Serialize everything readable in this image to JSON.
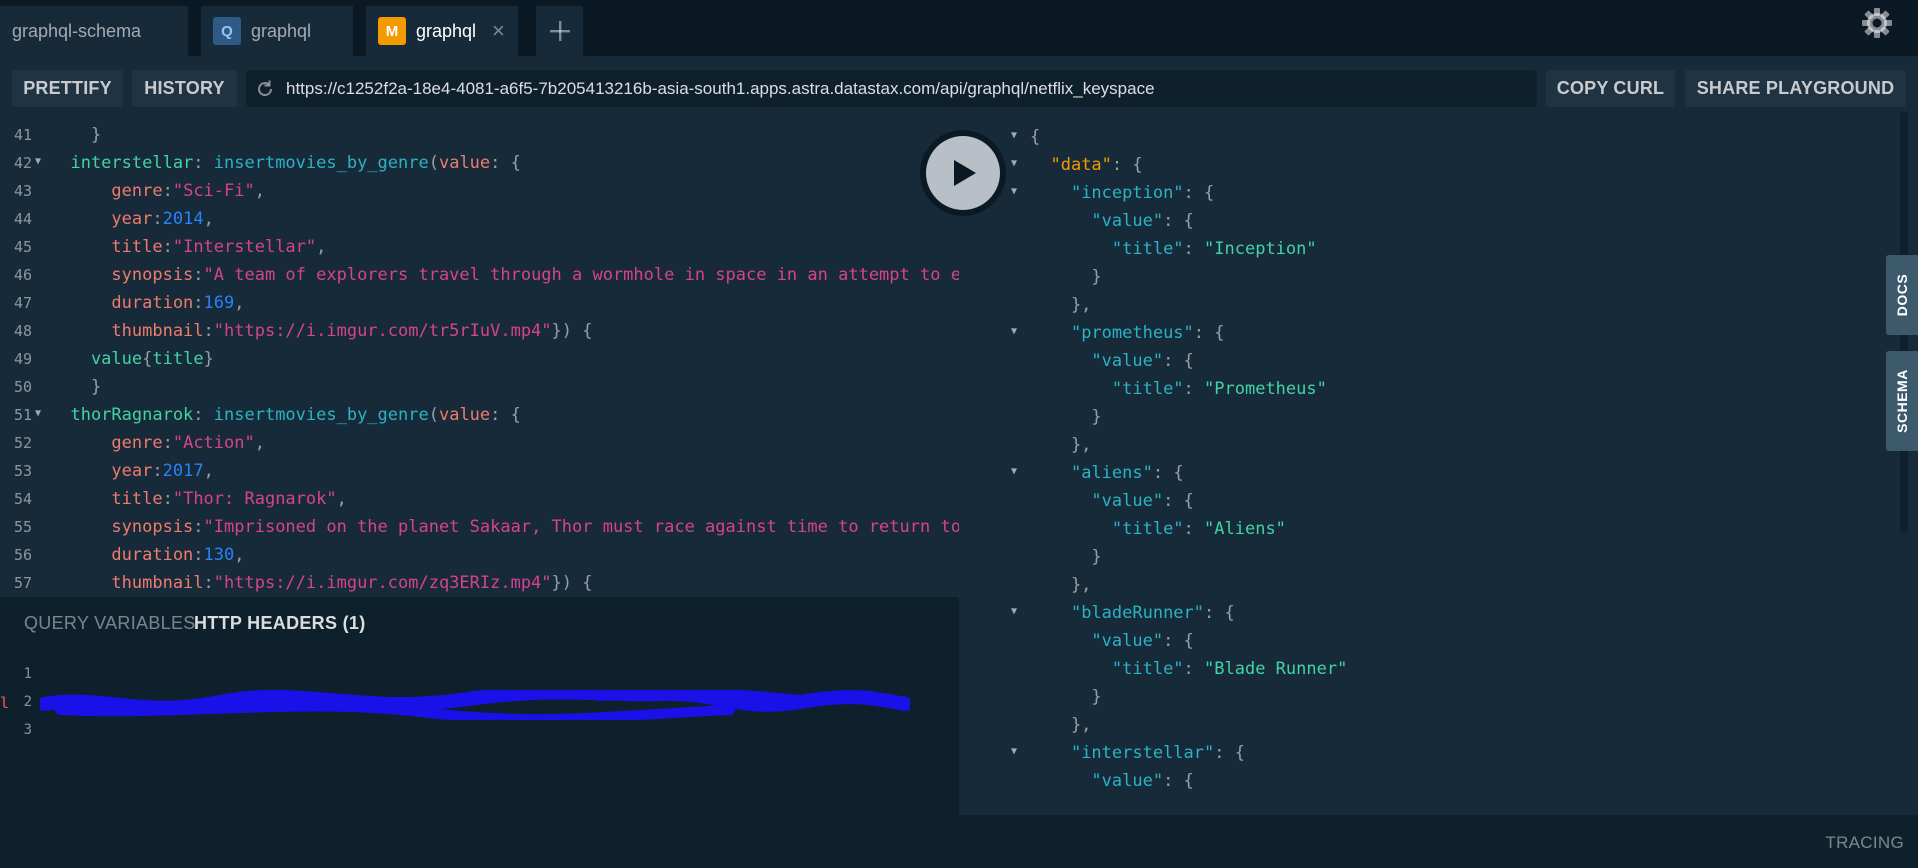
{
  "tabs": [
    {
      "label": "graphql-schema",
      "badge": ""
    },
    {
      "label": "graphql",
      "badge": "Q"
    },
    {
      "label": "graphql",
      "badge": "M",
      "close": "×"
    }
  ],
  "add_tab_icon": "+",
  "toolbar": {
    "prettify": "PRETTIFY",
    "history": "HISTORY",
    "url": "https://c1252f2a-18e4-4081-a6f5-7b205413216b-asia-south1.apps.astra.datastax.com/api/graphql/netflix_keyspace",
    "copy_curl": "COPY CURL",
    "share": "SHARE PLAYGROUND"
  },
  "editor": {
    "lines": [
      {
        "n": "41",
        "fold": false,
        "indent": 0,
        "tokens": [
          {
            "t": "    }",
            "c": "punc"
          }
        ]
      },
      {
        "n": "42",
        "fold": true,
        "indent": 0,
        "tokens": [
          {
            "t": "  interstellar",
            "c": "field"
          },
          {
            "t": ": ",
            "c": "punc"
          },
          {
            "t": "insertmovies_by_genre",
            "c": "def"
          },
          {
            "t": "(",
            "c": "punc"
          },
          {
            "t": "value",
            "c": "attr"
          },
          {
            "t": ": {",
            "c": "punc"
          }
        ]
      },
      {
        "n": "43",
        "fold": false,
        "indent": 0,
        "tokens": [
          {
            "t": "      genre",
            "c": "attr"
          },
          {
            "t": ":",
            "c": "punc"
          },
          {
            "t": "\"Sci-Fi\"",
            "c": "str"
          },
          {
            "t": ",",
            "c": "punc"
          }
        ]
      },
      {
        "n": "44",
        "fold": false,
        "indent": 0,
        "tokens": [
          {
            "t": "      year",
            "c": "attr"
          },
          {
            "t": ":",
            "c": "punc"
          },
          {
            "t": "2014",
            "c": "num"
          },
          {
            "t": ",",
            "c": "punc"
          }
        ]
      },
      {
        "n": "45",
        "fold": false,
        "indent": 0,
        "tokens": [
          {
            "t": "      title",
            "c": "attr"
          },
          {
            "t": ":",
            "c": "punc"
          },
          {
            "t": "\"Interstellar\"",
            "c": "str"
          },
          {
            "t": ",",
            "c": "punc"
          }
        ]
      },
      {
        "n": "46",
        "fold": false,
        "indent": 0,
        "tokens": [
          {
            "t": "      synopsis",
            "c": "attr"
          },
          {
            "t": ":",
            "c": "punc"
          },
          {
            "t": "\"A team of explorers travel through a wormhole in space in an attempt to e",
            "c": "str"
          }
        ]
      },
      {
        "n": "47",
        "fold": false,
        "indent": 0,
        "tokens": [
          {
            "t": "      duration",
            "c": "attr"
          },
          {
            "t": ":",
            "c": "punc"
          },
          {
            "t": "169",
            "c": "num"
          },
          {
            "t": ",",
            "c": "punc"
          }
        ]
      },
      {
        "n": "48",
        "fold": false,
        "indent": 0,
        "tokens": [
          {
            "t": "      thumbnail",
            "c": "attr"
          },
          {
            "t": ":",
            "c": "punc"
          },
          {
            "t": "\"https://i.imgur.com/tr5rIuV.mp4\"",
            "c": "str"
          },
          {
            "t": "}) {",
            "c": "punc"
          }
        ]
      },
      {
        "n": "49",
        "fold": false,
        "indent": 0,
        "tokens": [
          {
            "t": "    value",
            "c": "field"
          },
          {
            "t": "{",
            "c": "punc"
          },
          {
            "t": "title",
            "c": "field"
          },
          {
            "t": "}",
            "c": "punc"
          }
        ]
      },
      {
        "n": "50",
        "fold": false,
        "indent": 0,
        "tokens": [
          {
            "t": "    }",
            "c": "punc"
          }
        ]
      },
      {
        "n": "51",
        "fold": true,
        "indent": 0,
        "tokens": [
          {
            "t": "  thorRagnarok",
            "c": "field"
          },
          {
            "t": ": ",
            "c": "punc"
          },
          {
            "t": "insertmovies_by_genre",
            "c": "def"
          },
          {
            "t": "(",
            "c": "punc"
          },
          {
            "t": "value",
            "c": "attr"
          },
          {
            "t": ": {",
            "c": "punc"
          }
        ]
      },
      {
        "n": "52",
        "fold": false,
        "indent": 0,
        "tokens": [
          {
            "t": "      genre",
            "c": "attr"
          },
          {
            "t": ":",
            "c": "punc"
          },
          {
            "t": "\"Action\"",
            "c": "str"
          },
          {
            "t": ",",
            "c": "punc"
          }
        ]
      },
      {
        "n": "53",
        "fold": false,
        "indent": 0,
        "tokens": [
          {
            "t": "      year",
            "c": "attr"
          },
          {
            "t": ":",
            "c": "punc"
          },
          {
            "t": "2017",
            "c": "num"
          },
          {
            "t": ",",
            "c": "punc"
          }
        ]
      },
      {
        "n": "54",
        "fold": false,
        "indent": 0,
        "tokens": [
          {
            "t": "      title",
            "c": "attr"
          },
          {
            "t": ":",
            "c": "punc"
          },
          {
            "t": "\"Thor: Ragnarok\"",
            "c": "str"
          },
          {
            "t": ",",
            "c": "punc"
          }
        ]
      },
      {
        "n": "55",
        "fold": false,
        "indent": 0,
        "tokens": [
          {
            "t": "      synopsis",
            "c": "attr"
          },
          {
            "t": ":",
            "c": "punc"
          },
          {
            "t": "\"Imprisoned on the planet Sakaar, Thor must race against time to return to",
            "c": "str"
          }
        ]
      },
      {
        "n": "56",
        "fold": false,
        "indent": 0,
        "tokens": [
          {
            "t": "      duration",
            "c": "attr"
          },
          {
            "t": ":",
            "c": "punc"
          },
          {
            "t": "130",
            "c": "num"
          },
          {
            "t": ",",
            "c": "punc"
          }
        ]
      },
      {
        "n": "57",
        "fold": false,
        "indent": 0,
        "tokens": [
          {
            "t": "      thumbnail",
            "c": "attr"
          },
          {
            "t": ":",
            "c": "punc"
          },
          {
            "t": "\"https://i.imgur.com/zq3ERIz.mp4\"",
            "c": "str"
          },
          {
            "t": "}) {",
            "c": "punc"
          }
        ]
      }
    ]
  },
  "variables": {
    "tab_query": "QUERY VARIABLES",
    "tab_headers": "HTTP HEADERS (1)",
    "line_numbers": [
      "1",
      "2",
      "3"
    ]
  },
  "result": {
    "lines": [
      {
        "fold": true,
        "tokens": [
          {
            "t": "{",
            "c": "punc"
          }
        ]
      },
      {
        "fold": true,
        "tokens": [
          {
            "t": "  ",
            "c": "punc"
          },
          {
            "t": "\"data\"",
            "c": "key-top"
          },
          {
            "t": ": {",
            "c": "punc"
          }
        ]
      },
      {
        "fold": true,
        "tokens": [
          {
            "t": "    ",
            "c": "punc"
          },
          {
            "t": "\"inception\"",
            "c": "key"
          },
          {
            "t": ": {",
            "c": "punc"
          }
        ]
      },
      {
        "fold": false,
        "tokens": [
          {
            "t": "      ",
            "c": "punc"
          },
          {
            "t": "\"value\"",
            "c": "key"
          },
          {
            "t": ": {",
            "c": "punc"
          }
        ]
      },
      {
        "fold": false,
        "tokens": [
          {
            "t": "        ",
            "c": "punc"
          },
          {
            "t": "\"title\"",
            "c": "key"
          },
          {
            "t": ": ",
            "c": "punc"
          },
          {
            "t": "\"Inception\"",
            "c": "sval"
          }
        ]
      },
      {
        "fold": false,
        "tokens": [
          {
            "t": "      }",
            "c": "punc"
          }
        ]
      },
      {
        "fold": false,
        "tokens": [
          {
            "t": "    },",
            "c": "punc"
          }
        ]
      },
      {
        "fold": true,
        "tokens": [
          {
            "t": "    ",
            "c": "punc"
          },
          {
            "t": "\"prometheus\"",
            "c": "key"
          },
          {
            "t": ": {",
            "c": "punc"
          }
        ]
      },
      {
        "fold": false,
        "tokens": [
          {
            "t": "      ",
            "c": "punc"
          },
          {
            "t": "\"value\"",
            "c": "key"
          },
          {
            "t": ": {",
            "c": "punc"
          }
        ]
      },
      {
        "fold": false,
        "tokens": [
          {
            "t": "        ",
            "c": "punc"
          },
          {
            "t": "\"title\"",
            "c": "key"
          },
          {
            "t": ": ",
            "c": "punc"
          },
          {
            "t": "\"Prometheus\"",
            "c": "sval"
          }
        ]
      },
      {
        "fold": false,
        "tokens": [
          {
            "t": "      }",
            "c": "punc"
          }
        ]
      },
      {
        "fold": false,
        "tokens": [
          {
            "t": "    },",
            "c": "punc"
          }
        ]
      },
      {
        "fold": true,
        "tokens": [
          {
            "t": "    ",
            "c": "punc"
          },
          {
            "t": "\"aliens\"",
            "c": "key"
          },
          {
            "t": ": {",
            "c": "punc"
          }
        ]
      },
      {
        "fold": false,
        "tokens": [
          {
            "t": "      ",
            "c": "punc"
          },
          {
            "t": "\"value\"",
            "c": "key"
          },
          {
            "t": ": {",
            "c": "punc"
          }
        ]
      },
      {
        "fold": false,
        "tokens": [
          {
            "t": "        ",
            "c": "punc"
          },
          {
            "t": "\"title\"",
            "c": "key"
          },
          {
            "t": ": ",
            "c": "punc"
          },
          {
            "t": "\"Aliens\"",
            "c": "sval"
          }
        ]
      },
      {
        "fold": false,
        "tokens": [
          {
            "t": "      }",
            "c": "punc"
          }
        ]
      },
      {
        "fold": false,
        "tokens": [
          {
            "t": "    },",
            "c": "punc"
          }
        ]
      },
      {
        "fold": true,
        "tokens": [
          {
            "t": "    ",
            "c": "punc"
          },
          {
            "t": "\"bladeRunner\"",
            "c": "key"
          },
          {
            "t": ": {",
            "c": "punc"
          }
        ]
      },
      {
        "fold": false,
        "tokens": [
          {
            "t": "      ",
            "c": "punc"
          },
          {
            "t": "\"value\"",
            "c": "key"
          },
          {
            "t": ": {",
            "c": "punc"
          }
        ]
      },
      {
        "fold": false,
        "tokens": [
          {
            "t": "        ",
            "c": "punc"
          },
          {
            "t": "\"title\"",
            "c": "key"
          },
          {
            "t": ": ",
            "c": "punc"
          },
          {
            "t": "\"Blade Runner\"",
            "c": "sval"
          }
        ]
      },
      {
        "fold": false,
        "tokens": [
          {
            "t": "      }",
            "c": "punc"
          }
        ]
      },
      {
        "fold": false,
        "tokens": [
          {
            "t": "    },",
            "c": "punc"
          }
        ]
      },
      {
        "fold": true,
        "tokens": [
          {
            "t": "    ",
            "c": "punc"
          },
          {
            "t": "\"interstellar\"",
            "c": "key"
          },
          {
            "t": ": {",
            "c": "punc"
          }
        ]
      },
      {
        "fold": false,
        "tokens": [
          {
            "t": "      ",
            "c": "punc"
          },
          {
            "t": "\"value\"",
            "c": "key"
          },
          {
            "t": ": {",
            "c": "punc"
          }
        ]
      }
    ]
  },
  "side_tabs": {
    "docs": "DOCS",
    "schema": "SCHEMA"
  },
  "tracing": "TRACING",
  "icons": {
    "settings": "gear-icon",
    "play": "play-icon",
    "reload": "reload-icon",
    "fold": "fold-arrow-icon"
  },
  "colors": {
    "background": "#0f202d",
    "panel": "#172a3a",
    "orange_badge": "#f29a00",
    "string": "#d64292",
    "number": "#2882f9",
    "field": "#42d3a5",
    "attribute": "#ef7b6d",
    "redaction": "#1a10e8"
  }
}
